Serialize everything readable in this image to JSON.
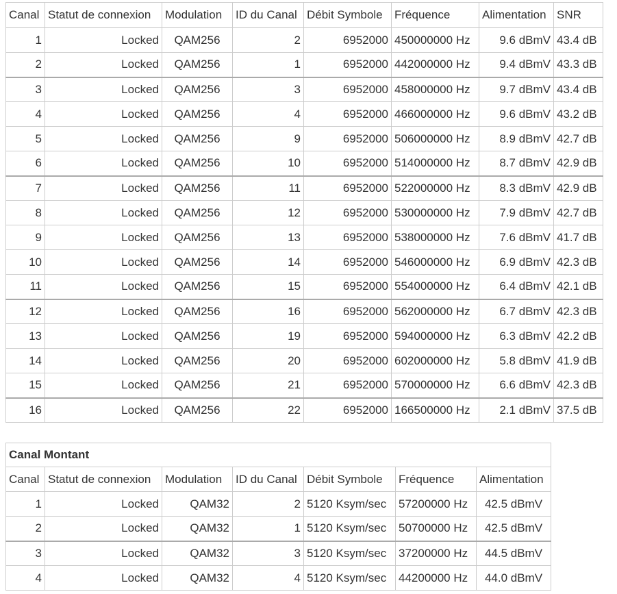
{
  "downstream": {
    "headers": [
      "Canal",
      "Statut de connexion",
      "Modulation",
      "ID du Canal",
      "Débit Symbole",
      "Fréquence",
      "Alimentation",
      "SNR"
    ],
    "rows": [
      [
        "1",
        "Locked",
        "QAM256",
        "2",
        "6952000",
        "450000000 Hz",
        "9.6 dBmV",
        "43.4 dB"
      ],
      [
        "2",
        "Locked",
        "QAM256",
        "1",
        "6952000",
        "442000000 Hz",
        "9.4 dBmV",
        "43.3 dB"
      ],
      [
        "3",
        "Locked",
        "QAM256",
        "3",
        "6952000",
        "458000000 Hz",
        "9.7 dBmV",
        "43.4 dB"
      ],
      [
        "4",
        "Locked",
        "QAM256",
        "4",
        "6952000",
        "466000000 Hz",
        "9.6 dBmV",
        "43.2 dB"
      ],
      [
        "5",
        "Locked",
        "QAM256",
        "9",
        "6952000",
        "506000000 Hz",
        "8.9 dBmV",
        "42.7 dB"
      ],
      [
        "6",
        "Locked",
        "QAM256",
        "10",
        "6952000",
        "514000000 Hz",
        "8.7 dBmV",
        "42.9 dB"
      ],
      [
        "7",
        "Locked",
        "QAM256",
        "11",
        "6952000",
        "522000000 Hz",
        "8.3 dBmV",
        "42.9 dB"
      ],
      [
        "8",
        "Locked",
        "QAM256",
        "12",
        "6952000",
        "530000000 Hz",
        "7.9 dBmV",
        "42.7 dB"
      ],
      [
        "9",
        "Locked",
        "QAM256",
        "13",
        "6952000",
        "538000000 Hz",
        "7.6 dBmV",
        "41.7 dB"
      ],
      [
        "10",
        "Locked",
        "QAM256",
        "14",
        "6952000",
        "546000000 Hz",
        "6.9 dBmV",
        "42.3 dB"
      ],
      [
        "11",
        "Locked",
        "QAM256",
        "15",
        "6952000",
        "554000000 Hz",
        "6.4 dBmV",
        "42.1 dB"
      ],
      [
        "12",
        "Locked",
        "QAM256",
        "16",
        "6952000",
        "562000000 Hz",
        "6.7 dBmV",
        "42.3 dB"
      ],
      [
        "13",
        "Locked",
        "QAM256",
        "19",
        "6952000",
        "594000000 Hz",
        "6.3 dBmV",
        "42.2 dB"
      ],
      [
        "14",
        "Locked",
        "QAM256",
        "20",
        "6952000",
        "602000000 Hz",
        "5.8 dBmV",
        "41.9 dB"
      ],
      [
        "15",
        "Locked",
        "QAM256",
        "21",
        "6952000",
        "570000000 Hz",
        "6.6 dBmV",
        "42.3 dB"
      ],
      [
        "16",
        "Locked",
        "QAM256",
        "22",
        "6952000",
        "166500000 Hz",
        "2.1 dBmV",
        "37.5 dB"
      ]
    ]
  },
  "upstream": {
    "caption": "Canal Montant",
    "headers": [
      "Canal",
      "Statut de connexion",
      "Modulation",
      "ID du Canal",
      "Débit Symbole",
      "Fréquence",
      "Alimentation"
    ],
    "rows": [
      [
        "1",
        "Locked",
        "QAM32",
        "2",
        "5120 Ksym/sec",
        "57200000 Hz",
        "42.5 dBmV"
      ],
      [
        "2",
        "Locked",
        "QAM32",
        "1",
        "5120 Ksym/sec",
        "50700000 Hz",
        "42.5 dBmV"
      ],
      [
        "3",
        "Locked",
        "QAM32",
        "3",
        "5120 Ksym/sec",
        "37200000 Hz",
        "44.5 dBmV"
      ],
      [
        "4",
        "Locked",
        "QAM32",
        "4",
        "5120 Ksym/sec",
        "44200000 Hz",
        "44.0 dBmV"
      ]
    ]
  }
}
